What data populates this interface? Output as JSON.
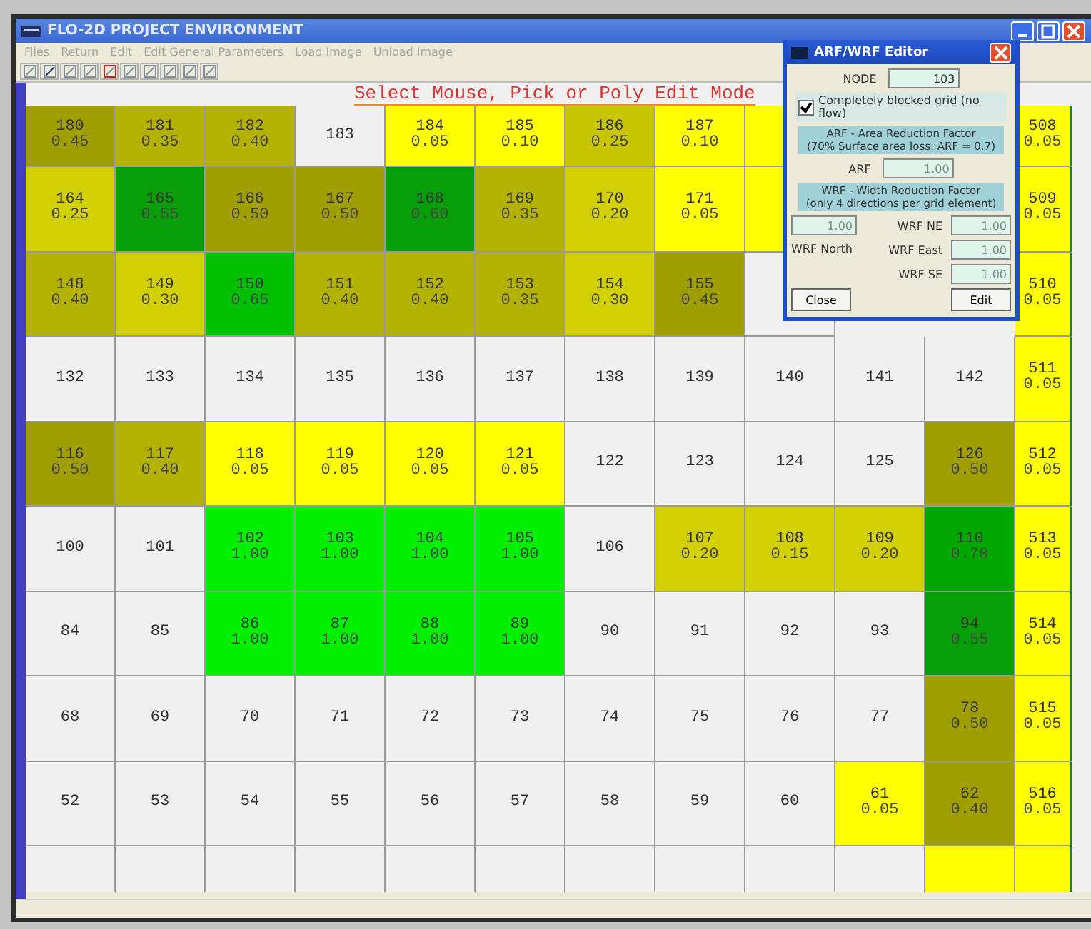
{
  "window": {
    "title": "FLO-2D PROJECT ENVIRONMENT"
  },
  "menu": [
    "Files",
    "Return",
    "Edit",
    "Edit General Parameters",
    "Load Image",
    "Unload Image"
  ],
  "mode_banner": "Select Mouse, Pick or Poly Edit Mode",
  "grid": {
    "rows": [
      {
        "cells": [
          {
            "node": "180",
            "value": "0.45",
            "color": "#a09e00"
          },
          {
            "node": "181",
            "value": "0.35",
            "color": "#b4b200"
          },
          {
            "node": "182",
            "value": "0.40",
            "color": "#b4b200"
          },
          {
            "node": "183",
            "color": "#f0f0f0"
          },
          {
            "node": "184",
            "value": "0.05",
            "color": "#ffff00"
          },
          {
            "node": "185",
            "value": "0.10",
            "color": "#ffff00"
          },
          {
            "node": "186",
            "value": "0.25",
            "color": "#c8c600"
          },
          {
            "node": "187",
            "value": "0.10",
            "color": "#ffff00"
          },
          {
            "color": "#ffff00"
          }
        ],
        "edge": {
          "node": "508",
          "value": "0.05",
          "color": "#ffff00"
        }
      },
      {
        "cells": [
          {
            "node": "164",
            "value": "0.25",
            "color": "#d2d000"
          },
          {
            "node": "165",
            "value": "0.55",
            "color": "#089e08"
          },
          {
            "node": "166",
            "value": "0.50",
            "color": "#a09e00"
          },
          {
            "node": "167",
            "value": "0.50",
            "color": "#a09e00"
          },
          {
            "node": "168",
            "value": "0.60",
            "color": "#089e08"
          },
          {
            "node": "169",
            "value": "0.35",
            "color": "#b4b200"
          },
          {
            "node": "170",
            "value": "0.20",
            "color": "#d2d000"
          },
          {
            "node": "171",
            "value": "0.05",
            "color": "#ffff00"
          },
          {
            "color": "#ffff00"
          }
        ],
        "edge": {
          "node": "509",
          "value": "0.05",
          "color": "#ffff00"
        }
      },
      {
        "cells": [
          {
            "node": "148",
            "value": "0.40",
            "color": "#b4b200"
          },
          {
            "node": "149",
            "value": "0.30",
            "color": "#d2d000"
          },
          {
            "node": "150",
            "value": "0.65",
            "color": "#00c000"
          },
          {
            "node": "151",
            "value": "0.40",
            "color": "#b4b200"
          },
          {
            "node": "152",
            "value": "0.40",
            "color": "#b4b200"
          },
          {
            "node": "153",
            "value": "0.35",
            "color": "#b4b200"
          },
          {
            "node": "154",
            "value": "0.30",
            "color": "#d2d000"
          },
          {
            "node": "155",
            "value": "0.45",
            "color": "#a09e00"
          },
          {
            "color": "#f0f0f0"
          }
        ],
        "edge": {
          "node": "510",
          "value": "0.05",
          "color": "#ffff00"
        }
      },
      {
        "cells": [
          {
            "node": "132",
            "color": "#f0f0f0"
          },
          {
            "node": "133",
            "color": "#f0f0f0"
          },
          {
            "node": "134",
            "color": "#f0f0f0"
          },
          {
            "node": "135",
            "color": "#f0f0f0"
          },
          {
            "node": "136",
            "color": "#f0f0f0"
          },
          {
            "node": "137",
            "color": "#f0f0f0"
          },
          {
            "node": "138",
            "color": "#f0f0f0"
          },
          {
            "node": "139",
            "color": "#f0f0f0"
          },
          {
            "node": "140",
            "color": "#f0f0f0"
          },
          {
            "node": "141",
            "color": "#f0f0f0"
          },
          {
            "node": "142",
            "color": "#f0f0f0"
          }
        ],
        "edge": {
          "node": "511",
          "value": "0.05",
          "color": "#ffff00"
        }
      },
      {
        "cells": [
          {
            "node": "116",
            "value": "0.50",
            "color": "#a09e00"
          },
          {
            "node": "117",
            "value": "0.40",
            "color": "#b4b200"
          },
          {
            "node": "118",
            "value": "0.05",
            "color": "#ffff00"
          },
          {
            "node": "119",
            "value": "0.05",
            "color": "#ffff00"
          },
          {
            "node": "120",
            "value": "0.05",
            "color": "#ffff00"
          },
          {
            "node": "121",
            "value": "0.05",
            "color": "#ffff00"
          },
          {
            "node": "122",
            "color": "#f0f0f0"
          },
          {
            "node": "123",
            "color": "#f0f0f0"
          },
          {
            "node": "124",
            "color": "#f0f0f0"
          },
          {
            "node": "125",
            "color": "#f0f0f0"
          },
          {
            "node": "126",
            "value": "0.50",
            "color": "#a09e00"
          }
        ],
        "edge": {
          "node": "512",
          "value": "0.05",
          "color": "#ffff00"
        }
      },
      {
        "cells": [
          {
            "node": "100",
            "color": "#f0f0f0"
          },
          {
            "node": "101",
            "color": "#f0f0f0"
          },
          {
            "node": "102",
            "value": "1.00",
            "color": "#00f000"
          },
          {
            "node": "103",
            "value": "1.00",
            "color": "#00f000"
          },
          {
            "node": "104",
            "value": "1.00",
            "color": "#00f000"
          },
          {
            "node": "105",
            "value": "1.00",
            "color": "#00f000"
          },
          {
            "node": "106",
            "color": "#f0f0f0"
          },
          {
            "node": "107",
            "value": "0.20",
            "color": "#d2d000"
          },
          {
            "node": "108",
            "value": "0.15",
            "color": "#d2d000"
          },
          {
            "node": "109",
            "value": "0.20",
            "color": "#d2d000"
          },
          {
            "node": "110",
            "value": "0.70",
            "color": "#00a800"
          }
        ],
        "edge": {
          "node": "513",
          "value": "0.05",
          "color": "#ffff00"
        }
      },
      {
        "cells": [
          {
            "node": "84",
            "color": "#f0f0f0"
          },
          {
            "node": "85",
            "color": "#f0f0f0"
          },
          {
            "node": "86",
            "value": "1.00",
            "color": "#00f000"
          },
          {
            "node": "87",
            "value": "1.00",
            "color": "#00f000"
          },
          {
            "node": "88",
            "value": "1.00",
            "color": "#00f000"
          },
          {
            "node": "89",
            "value": "1.00",
            "color": "#00f000"
          },
          {
            "node": "90",
            "color": "#f0f0f0"
          },
          {
            "node": "91",
            "color": "#f0f0f0"
          },
          {
            "node": "92",
            "color": "#f0f0f0"
          },
          {
            "node": "93",
            "color": "#f0f0f0"
          },
          {
            "node": "94",
            "value": "0.55",
            "color": "#089e08"
          }
        ],
        "edge": {
          "node": "514",
          "value": "0.05",
          "color": "#ffff00"
        }
      },
      {
        "cells": [
          {
            "node": "68",
            "color": "#f0f0f0"
          },
          {
            "node": "69",
            "color": "#f0f0f0"
          },
          {
            "node": "70",
            "color": "#f0f0f0"
          },
          {
            "node": "71",
            "color": "#f0f0f0"
          },
          {
            "node": "72",
            "color": "#f0f0f0"
          },
          {
            "node": "73",
            "color": "#f0f0f0"
          },
          {
            "node": "74",
            "color": "#f0f0f0"
          },
          {
            "node": "75",
            "color": "#f0f0f0"
          },
          {
            "node": "76",
            "color": "#f0f0f0"
          },
          {
            "node": "77",
            "color": "#f0f0f0"
          },
          {
            "node": "78",
            "value": "0.50",
            "color": "#a09e00"
          }
        ],
        "edge": {
          "node": "515",
          "value": "0.05",
          "color": "#ffff00"
        }
      },
      {
        "cells": [
          {
            "node": "52",
            "color": "#f0f0f0"
          },
          {
            "node": "53",
            "color": "#f0f0f0"
          },
          {
            "node": "54",
            "color": "#f0f0f0"
          },
          {
            "node": "55",
            "color": "#f0f0f0"
          },
          {
            "node": "56",
            "color": "#f0f0f0"
          },
          {
            "node": "57",
            "color": "#f0f0f0"
          },
          {
            "node": "58",
            "color": "#f0f0f0"
          },
          {
            "node": "59",
            "color": "#f0f0f0"
          },
          {
            "node": "60",
            "color": "#f0f0f0"
          },
          {
            "node": "61",
            "value": "0.05",
            "color": "#ffff00"
          },
          {
            "node": "62",
            "value": "0.40",
            "color": "#a09e00"
          }
        ],
        "edge": {
          "node": "516",
          "value": "0.05",
          "color": "#ffff00"
        }
      },
      {
        "cells": [
          {
            "color": "#f0f0f0"
          },
          {
            "color": "#f0f0f0"
          },
          {
            "color": "#f0f0f0"
          },
          {
            "color": "#f0f0f0"
          },
          {
            "color": "#f0f0f0"
          },
          {
            "color": "#f0f0f0"
          },
          {
            "color": "#f0f0f0"
          },
          {
            "color": "#f0f0f0"
          },
          {
            "color": "#f0f0f0"
          },
          {
            "color": "#f0f0f0"
          },
          {
            "color": "#ffff00"
          }
        ],
        "edge": {
          "color": "#ffff00"
        }
      }
    ]
  },
  "dialog": {
    "title": "ARF/WRF Editor",
    "node_label": "NODE",
    "node_value": "103",
    "blocked": {
      "label": "Completely blocked grid (no flow)",
      "checked": true
    },
    "arf_header": [
      "ARF - Area Reduction Factor",
      "(70% Surface area loss: ARF = 0.7)"
    ],
    "arf": {
      "label": "ARF",
      "value": "1.00",
      "disabled": true
    },
    "wrf_header": [
      "WRF - Width Reduction Factor",
      "(only 4 directions per grid element)"
    ],
    "wrf_north": {
      "label": "WRF North",
      "value": "1.00",
      "disabled": true
    },
    "wrf_right": [
      {
        "label": "WRF NE",
        "value": "1.00",
        "disabled": true
      },
      {
        "label": "WRF East",
        "value": "1.00",
        "disabled": true
      },
      {
        "label": "WRF SE",
        "value": "1.00",
        "disabled": true
      }
    ],
    "buttons": [
      "Close",
      "Edit"
    ]
  }
}
